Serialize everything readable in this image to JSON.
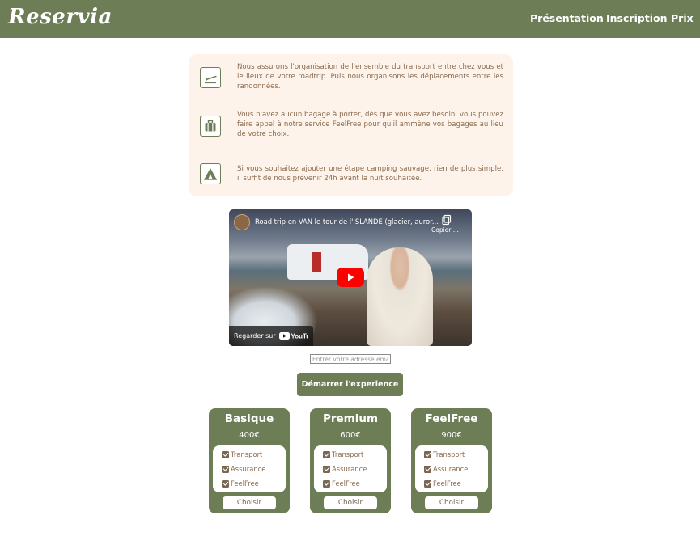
{
  "brand": {
    "logo": "Reservia"
  },
  "nav": {
    "links": [
      "Présentation",
      "Inscription",
      "Prix"
    ]
  },
  "features": [
    {
      "icon": "plane-icon",
      "text": "Nous assurons l'organisation de l'ensemble du transport entre chez vous et le lieux de votre roadtrip. Puis nous organisons les déplacements entre les randonnées."
    },
    {
      "icon": "suitcase-icon",
      "text": "Vous n'avez aucun bagage à porter, dès que vous avez besoin, vous pouvez faire appel à notre service FeelFree pour qu'il ammène vos bagages au lieu de votre choix."
    },
    {
      "icon": "tent-icon",
      "text": "Si vous souhaitez ajouter une étape camping sauvage, rien de plus simple, il suffit de nous prévenir 24h avant la nuit souhaitée."
    }
  ],
  "video": {
    "title": "Road trip en VAN le tour de l'ISLANDE (glacier, auror...",
    "copy_label": "Copier ...",
    "watch_label": "Regarder sur",
    "platform": "YouTube"
  },
  "signup": {
    "email_placeholder": "Entrer votre adresse email",
    "cta_label": "Démarrer l'experience"
  },
  "plans": [
    {
      "name": "Basique",
      "price": "400€",
      "features": [
        "Transport",
        "Assurance",
        "FeelFree"
      ],
      "button": "Choisir"
    },
    {
      "name": "Premium",
      "price": "600€",
      "features": [
        "Transport",
        "Assurance",
        "FeelFree"
      ],
      "button": "Choisir"
    },
    {
      "name": "FeelFree",
      "price": "900€",
      "features": [
        "Transport",
        "Assurance",
        "FeelFree"
      ],
      "button": "Choisir"
    }
  ],
  "colors": {
    "brand_green": "#6d7d56",
    "card_beige": "#fdf3ea",
    "text_brown": "#8a6a4e"
  }
}
